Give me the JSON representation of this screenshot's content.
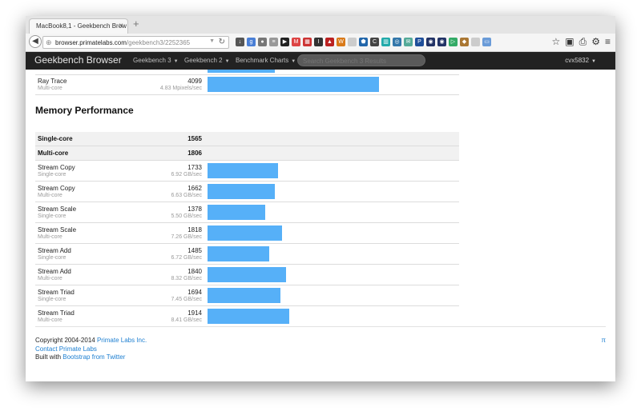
{
  "browser": {
    "tab_title": "MacBook8,1 - Geekbench Brow…",
    "url_host": "browser.primatelabs.com",
    "url_path": "/geekbench3/2252365"
  },
  "navbar": {
    "brand": "Geekbench Browser",
    "items": [
      "Geekbench 3",
      "Geekbench 2",
      "Benchmark Charts"
    ],
    "search_placeholder": "Search Geekbench 3 Results",
    "user": "cvx5832"
  },
  "prior_row": {
    "name": "Ray Trace",
    "sub": "Multi-core",
    "score": "4099",
    "rate": "4.83 Mpixels/sec",
    "fraction": 0.46
  },
  "section_title": "Memory Performance",
  "summary": [
    {
      "name": "Single-core",
      "score": "1565"
    },
    {
      "name": "Multi-core",
      "score": "1806"
    }
  ],
  "rows": [
    {
      "name": "Stream Copy",
      "sub": "Single-core",
      "score": "1733",
      "rate": "6.92 GB/sec",
      "fraction": 0.19
    },
    {
      "name": "Stream Copy",
      "sub": "Multi-core",
      "score": "1662",
      "rate": "6.63 GB/sec",
      "fraction": 0.18
    },
    {
      "name": "Stream Scale",
      "sub": "Single-core",
      "score": "1378",
      "rate": "5.50 GB/sec",
      "fraction": 0.155
    },
    {
      "name": "Stream Scale",
      "sub": "Multi-core",
      "score": "1818",
      "rate": "7.26 GB/sec",
      "fraction": 0.2
    },
    {
      "name": "Stream Add",
      "sub": "Single-core",
      "score": "1485",
      "rate": "6.72 GB/sec",
      "fraction": 0.165
    },
    {
      "name": "Stream Add",
      "sub": "Multi-core",
      "score": "1840",
      "rate": "8.32 GB/sec",
      "fraction": 0.21
    },
    {
      "name": "Stream Triad",
      "sub": "Single-core",
      "score": "1694",
      "rate": "7.45 GB/sec",
      "fraction": 0.195
    },
    {
      "name": "Stream Triad",
      "sub": "Multi-core",
      "score": "1914",
      "rate": "8.41 GB/sec",
      "fraction": 0.22
    }
  ],
  "footer": {
    "copyright_prefix": "Copyright 2004-2014",
    "company_link": "Primate Labs Inc.",
    "contact_link": "Contact Primate Labs",
    "built_prefix": "Built with",
    "bootstrap_link": "Bootstrap from Twitter",
    "pi": "π"
  },
  "colors": {
    "bar": "#56b0f8",
    "navbar": "#222222",
    "link": "#1d7fd1"
  }
}
